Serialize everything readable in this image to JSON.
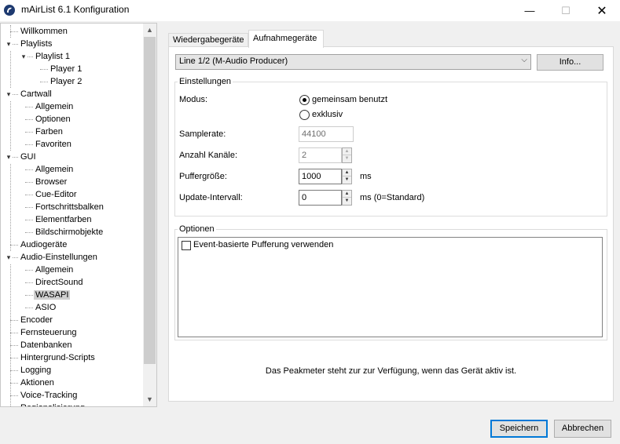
{
  "window": {
    "title": "mAirList 6.1 Konfiguration",
    "icon": "mairlist-logo-icon",
    "controls": {
      "minimize": "—",
      "maximize": "☐",
      "close": "✕"
    }
  },
  "tree": {
    "items": [
      {
        "label": "Willkommen",
        "level": 0,
        "toggle": ""
      },
      {
        "label": "Playlists",
        "level": 0,
        "toggle": "▾"
      },
      {
        "label": "Playlist 1",
        "level": 1,
        "toggle": "▾"
      },
      {
        "label": "Player 1",
        "level": 2,
        "toggle": ""
      },
      {
        "label": "Player 2",
        "level": 2,
        "toggle": ""
      },
      {
        "label": "Cartwall",
        "level": 0,
        "toggle": "▾"
      },
      {
        "label": "Allgemein",
        "level": 1,
        "toggle": ""
      },
      {
        "label": "Optionen",
        "level": 1,
        "toggle": ""
      },
      {
        "label": "Farben",
        "level": 1,
        "toggle": ""
      },
      {
        "label": "Favoriten",
        "level": 1,
        "toggle": ""
      },
      {
        "label": "GUI",
        "level": 0,
        "toggle": "▾"
      },
      {
        "label": "Allgemein",
        "level": 1,
        "toggle": ""
      },
      {
        "label": "Browser",
        "level": 1,
        "toggle": ""
      },
      {
        "label": "Cue-Editor",
        "level": 1,
        "toggle": ""
      },
      {
        "label": "Fortschrittsbalken",
        "level": 1,
        "toggle": ""
      },
      {
        "label": "Elementfarben",
        "level": 1,
        "toggle": ""
      },
      {
        "label": "Bildschirmobjekte",
        "level": 1,
        "toggle": ""
      },
      {
        "label": "Audiogeräte",
        "level": 0,
        "toggle": ""
      },
      {
        "label": "Audio-Einstellungen",
        "level": 0,
        "toggle": "▾"
      },
      {
        "label": "Allgemein",
        "level": 1,
        "toggle": ""
      },
      {
        "label": "DirectSound",
        "level": 1,
        "toggle": ""
      },
      {
        "label": "WASAPI",
        "level": 1,
        "toggle": "",
        "selected": true
      },
      {
        "label": "ASIO",
        "level": 1,
        "toggle": ""
      },
      {
        "label": "Encoder",
        "level": 0,
        "toggle": ""
      },
      {
        "label": "Fernsteuerung",
        "level": 0,
        "toggle": ""
      },
      {
        "label": "Datenbanken",
        "level": 0,
        "toggle": ""
      },
      {
        "label": "Hintergrund-Scripts",
        "level": 0,
        "toggle": ""
      },
      {
        "label": "Logging",
        "level": 0,
        "toggle": ""
      },
      {
        "label": "Aktionen",
        "level": 0,
        "toggle": ""
      },
      {
        "label": "Voice-Tracking",
        "level": 0,
        "toggle": ""
      },
      {
        "label": "Regionalisierung",
        "level": 0,
        "toggle": ""
      }
    ],
    "scroll_up": "▲",
    "scroll_down": "▼"
  },
  "tabs": [
    {
      "label": "Wiedergabegeräte",
      "active": false
    },
    {
      "label": "Aufnahmegeräte",
      "active": true
    }
  ],
  "device": {
    "selected": "Line 1/2 (M-Audio Producer)",
    "dropdown_arrow": "⌵",
    "info_button": "Info..."
  },
  "settings": {
    "group_title": "Einstellungen",
    "mode_label": "Modus:",
    "mode_options": [
      {
        "label": "gemeinsam benutzt",
        "checked": true
      },
      {
        "label": "exklusiv",
        "checked": false
      }
    ],
    "samplerate_label": "Samplerate:",
    "samplerate_value": "44100",
    "channels_label": "Anzahl Kanäle:",
    "channels_value": "2",
    "buffer_label": "Puffergröße:",
    "buffer_value": "1000",
    "buffer_unit": "ms",
    "update_label": "Update-Intervall:",
    "update_value": "0",
    "update_unit": "ms (0=Standard)"
  },
  "options": {
    "group_title": "Optionen",
    "items": [
      {
        "label": "Event-basierte Pufferung verwenden",
        "checked": false
      }
    ]
  },
  "status": "Das Peakmeter steht zur zur Verfügung, wenn das Gerät aktiv ist.",
  "footer": {
    "save": "Speichern",
    "cancel": "Abbrechen"
  }
}
